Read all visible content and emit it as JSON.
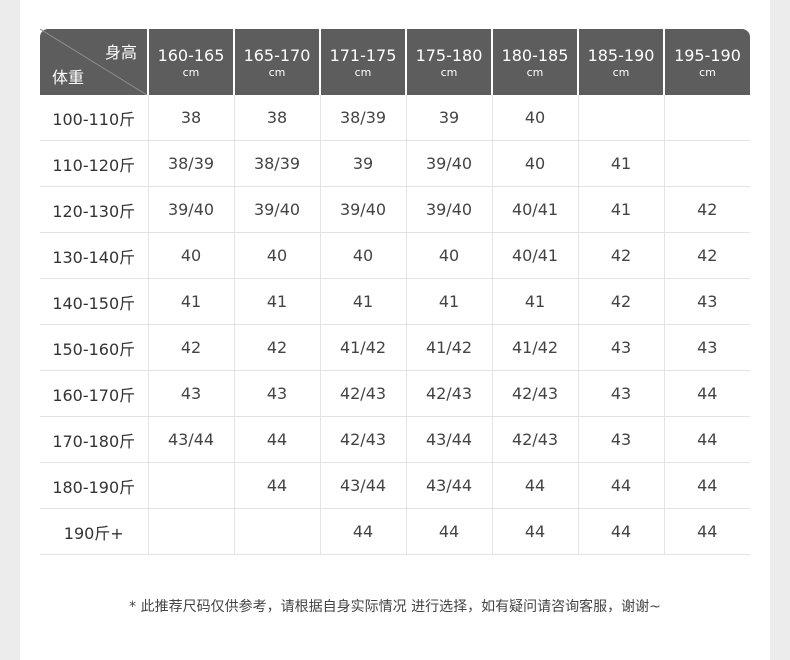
{
  "header": {
    "corner_top": "身高",
    "corner_bottom": "体重",
    "columns": [
      {
        "range": "160-165",
        "unit": "cm"
      },
      {
        "range": "165-170",
        "unit": "cm"
      },
      {
        "range": "171-175",
        "unit": "cm"
      },
      {
        "range": "175-180",
        "unit": "cm"
      },
      {
        "range": "180-185",
        "unit": "cm"
      },
      {
        "range": "185-190",
        "unit": "cm"
      },
      {
        "range": "195-190",
        "unit": "cm"
      }
    ]
  },
  "rows": [
    {
      "label": "100-110斤",
      "cells": [
        "38",
        "38",
        "38/39",
        "39",
        "40",
        "",
        ""
      ]
    },
    {
      "label": "110-120斤",
      "cells": [
        "38/39",
        "38/39",
        "39",
        "39/40",
        "40",
        "41",
        ""
      ]
    },
    {
      "label": "120-130斤",
      "cells": [
        "39/40",
        "39/40",
        "39/40",
        "39/40",
        "40/41",
        "41",
        "42"
      ]
    },
    {
      "label": "130-140斤",
      "cells": [
        "40",
        "40",
        "40",
        "40",
        "40/41",
        "42",
        "42"
      ]
    },
    {
      "label": "140-150斤",
      "cells": [
        "41",
        "41",
        "41",
        "41",
        "41",
        "42",
        "43"
      ]
    },
    {
      "label": "150-160斤",
      "cells": [
        "42",
        "42",
        "41/42",
        "41/42",
        "41/42",
        "43",
        "43"
      ]
    },
    {
      "label": "160-170斤",
      "cells": [
        "43",
        "43",
        "42/43",
        "42/43",
        "42/43",
        "43",
        "44"
      ]
    },
    {
      "label": "170-180斤",
      "cells": [
        "43/44",
        "44",
        "42/43",
        "43/44",
        "42/43",
        "43",
        "44"
      ]
    },
    {
      "label": "180-190斤",
      "cells": [
        "",
        "44",
        "43/44",
        "43/44",
        "44",
        "44",
        "44"
      ]
    },
    {
      "label": "190斤+",
      "cells": [
        "",
        "",
        "44",
        "44",
        "44",
        "44",
        "44"
      ]
    }
  ],
  "note": "* 此推荐尺码仅供参考，请根据自身实际情况 进行选择，如有疑问请咨询客服，谢谢~"
}
